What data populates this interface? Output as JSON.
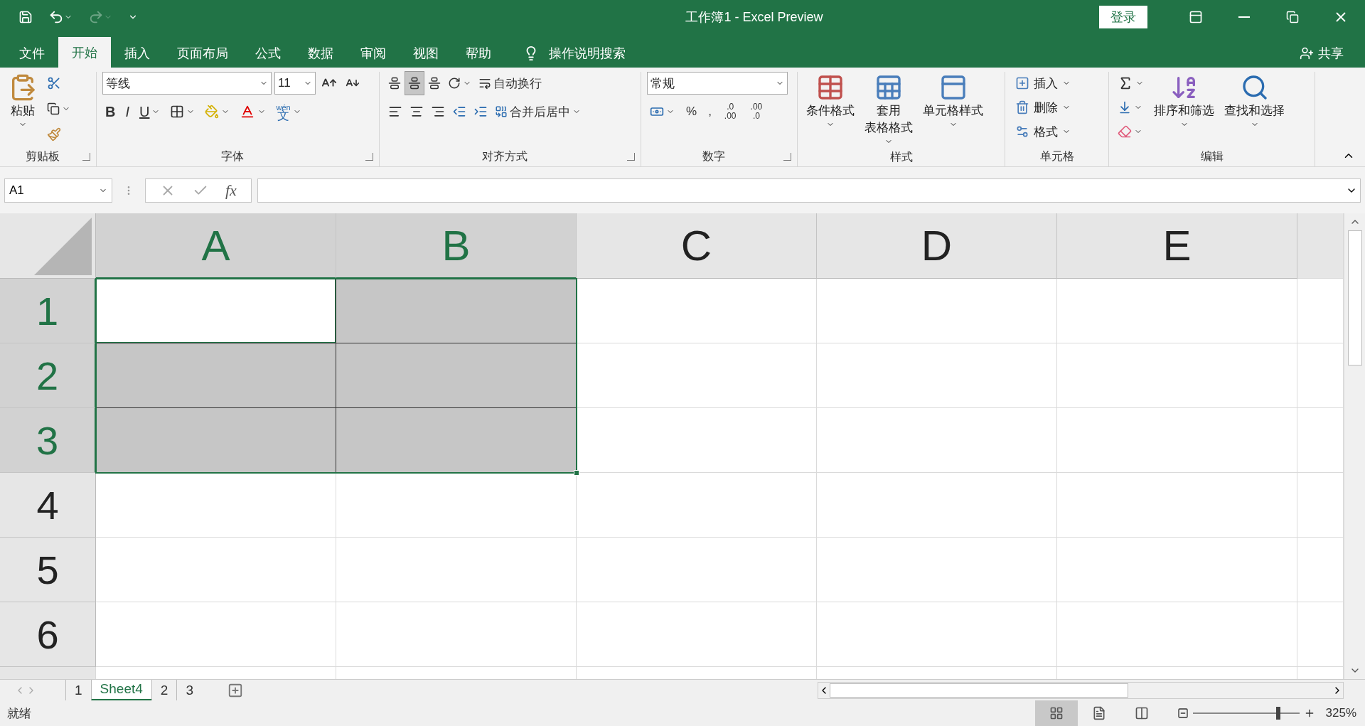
{
  "window": {
    "title": "工作簿1  -  Excel Preview",
    "sign_in": "登录",
    "share": "共享"
  },
  "tabs": [
    {
      "label": "文件",
      "selected": false
    },
    {
      "label": "开始",
      "selected": true
    },
    {
      "label": "插入",
      "selected": false
    },
    {
      "label": "页面布局",
      "selected": false
    },
    {
      "label": "公式",
      "selected": false
    },
    {
      "label": "数据",
      "selected": false
    },
    {
      "label": "审阅",
      "selected": false
    },
    {
      "label": "视图",
      "selected": false
    },
    {
      "label": "帮助",
      "selected": false
    }
  ],
  "tell_me": "操作说明搜索",
  "ribbon": {
    "clipboard": {
      "label": "剪贴板",
      "paste": "粘贴"
    },
    "font": {
      "label": "字体",
      "font_name": "等线",
      "font_size": "11",
      "bold": "B",
      "italic": "I",
      "underline": "U",
      "phonetic_top": "wén",
      "phonetic_bottom": "文"
    },
    "alignment": {
      "label": "对齐方式",
      "vertical": [
        {
          "selected": false
        },
        {
          "selected": true
        },
        {
          "selected": false
        }
      ],
      "wrap_text": "自动换行",
      "merge_center": "合并后居中"
    },
    "number": {
      "label": "数字",
      "format": "常规",
      "percent": "%",
      "comma": ",",
      "increase_decimal": [
        ".0",
        ".00"
      ],
      "decrease_decimal": [
        ".00",
        ".0"
      ]
    },
    "styles": {
      "label": "样式",
      "items": [
        {
          "kind": "conditional",
          "lines": [
            "条件格式"
          ]
        },
        {
          "kind": "table",
          "lines": [
            "套用",
            "表格格式"
          ]
        },
        {
          "kind": "cell",
          "lines": [
            "单元格样式"
          ]
        }
      ]
    },
    "cells": {
      "label": "单元格",
      "items": [
        "插入",
        "删除",
        "格式"
      ]
    },
    "editing": {
      "label": "编辑",
      "sort_filter": "排序和筛选",
      "find_select": "查找和选择"
    }
  },
  "formula_bar": {
    "name_box": "A1",
    "fx": "fx"
  },
  "sheet": {
    "columns": [
      {
        "label": "A",
        "selected": true
      },
      {
        "label": "B",
        "selected": true
      },
      {
        "label": "C",
        "selected": false
      },
      {
        "label": "D",
        "selected": false
      },
      {
        "label": "E",
        "selected": false
      }
    ],
    "rows": [
      {
        "label": "1",
        "selected": true,
        "cells": [
          {
            "selected": true,
            "active": true
          },
          {
            "selected": true,
            "active": false
          },
          {
            "selected": false,
            "active": false
          },
          {
            "selected": false,
            "active": false
          },
          {
            "selected": false,
            "active": false
          }
        ]
      },
      {
        "label": "2",
        "selected": true,
        "cells": [
          {
            "selected": true,
            "active": false
          },
          {
            "selected": true,
            "active": false
          },
          {
            "selected": false,
            "active": false
          },
          {
            "selected": false,
            "active": false
          },
          {
            "selected": false,
            "active": false
          }
        ]
      },
      {
        "label": "3",
        "selected": true,
        "cells": [
          {
            "selected": true,
            "active": false
          },
          {
            "selected": true,
            "active": false
          },
          {
            "selected": false,
            "active": false
          },
          {
            "selected": false,
            "active": false
          },
          {
            "selected": false,
            "active": false
          }
        ]
      },
      {
        "label": "4",
        "selected": false,
        "cells": [
          {
            "selected": false,
            "active": false
          },
          {
            "selected": false,
            "active": false
          },
          {
            "selected": false,
            "active": false
          },
          {
            "selected": false,
            "active": false
          },
          {
            "selected": false,
            "active": false
          }
        ]
      },
      {
        "label": "5",
        "selected": false,
        "cells": [
          {
            "selected": false,
            "active": false
          },
          {
            "selected": false,
            "active": false
          },
          {
            "selected": false,
            "active": false
          },
          {
            "selected": false,
            "active": false
          },
          {
            "selected": false,
            "active": false
          }
        ]
      },
      {
        "label": "6",
        "selected": false,
        "cells": [
          {
            "selected": false,
            "active": false
          },
          {
            "selected": false,
            "active": false
          },
          {
            "selected": false,
            "active": false
          },
          {
            "selected": false,
            "active": false
          },
          {
            "selected": false,
            "active": false
          }
        ]
      }
    ]
  },
  "sheet_tabs": [
    {
      "label": "1",
      "selected": false
    },
    {
      "label": "Sheet4",
      "selected": true
    },
    {
      "label": "2",
      "selected": false
    },
    {
      "label": "3",
      "selected": false
    }
  ],
  "status_bar": {
    "status": "就绪",
    "views": [
      {
        "kind": "normal",
        "selected": true
      },
      {
        "kind": "page_layout",
        "selected": false
      },
      {
        "kind": "page_break",
        "selected": false
      }
    ],
    "zoom_slider": {
      "level": 0.78
    },
    "zoom": "325%"
  }
}
